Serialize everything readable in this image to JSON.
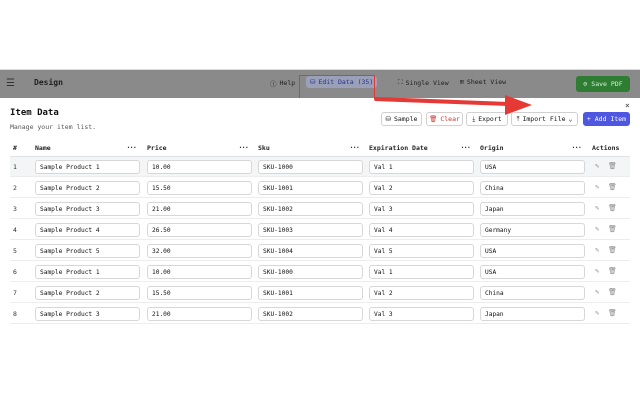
{
  "app": {
    "title": "Design",
    "toolbar": {
      "help": "Help",
      "edit_data": "Edit Data (35)",
      "single_view": "Single View",
      "sheet_view": "Sheet View",
      "save_pdf": "Save PDF"
    }
  },
  "modal": {
    "title": "Item Data",
    "subtitle": "Manage your item list.",
    "close": "×",
    "buttons": {
      "sample": "Sample",
      "clear": "Clear",
      "export": "Export",
      "import": "Import File",
      "add": "+ Add Item"
    }
  },
  "table": {
    "columns": [
      "#",
      "Name",
      "Price",
      "Sku",
      "Expiration Date",
      "Origin",
      "Actions"
    ],
    "rows": [
      {
        "n": "1",
        "name": "Sample Product 1",
        "price": "10.00",
        "sku": "SKU-1000",
        "exp": "Val 1",
        "origin": "USA"
      },
      {
        "n": "2",
        "name": "Sample Product 2",
        "price": "15.50",
        "sku": "SKU-1001",
        "exp": "Val 2",
        "origin": "China"
      },
      {
        "n": "3",
        "name": "Sample Product 3",
        "price": "21.00",
        "sku": "SKU-1002",
        "exp": "Val 3",
        "origin": "Japan"
      },
      {
        "n": "4",
        "name": "Sample Product 4",
        "price": "26.50",
        "sku": "SKU-1003",
        "exp": "Val 4",
        "origin": "Germany"
      },
      {
        "n": "5",
        "name": "Sample Product 5",
        "price": "32.00",
        "sku": "SKU-1004",
        "exp": "Val 5",
        "origin": "USA"
      },
      {
        "n": "6",
        "name": "Sample Product 1",
        "price": "10.00",
        "sku": "SKU-1000",
        "exp": "Val 1",
        "origin": "USA"
      },
      {
        "n": "7",
        "name": "Sample Product 2",
        "price": "15.50",
        "sku": "SKU-1001",
        "exp": "Val 2",
        "origin": "China"
      },
      {
        "n": "8",
        "name": "Sample Product 3",
        "price": "21.00",
        "sku": "SKU-1002",
        "exp": "Val 3",
        "origin": "Japan"
      }
    ]
  },
  "colors": {
    "accent": "#4f56e0",
    "danger": "#d32f2f",
    "save": "#2e7d32",
    "annotation": "#e53935"
  }
}
